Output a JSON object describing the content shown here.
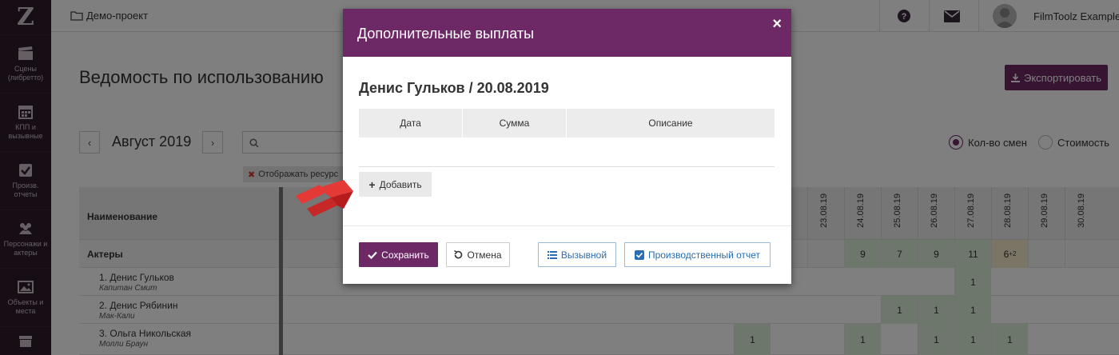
{
  "sidebar": {
    "logo": "Z",
    "items": [
      {
        "label": "Сцены (либретто)",
        "icon": "clapperboard-icon"
      },
      {
        "label": "КПП и вызывные",
        "icon": "calendar-icon"
      },
      {
        "label": "Произв. отчеты",
        "icon": "checkbox-icon"
      },
      {
        "label": "Персонажи и актеры",
        "icon": "people-icon"
      },
      {
        "label": "Объекты и места",
        "icon": "image-icon"
      }
    ]
  },
  "topbar": {
    "breadcrumb": "Демо-проект",
    "user_name": "FilmToolz Example"
  },
  "page": {
    "title": "Ведомость по использованию",
    "export_label": "Экспортировать",
    "month": "Август 2019",
    "radio_shifts": "Кол-во смен",
    "radio_cost": "Стоимость",
    "filter_label": "Отображать ресурс"
  },
  "table": {
    "name_header": "Наименование",
    "dates": [
      "23.08.19",
      "24.08.19",
      "25.08.19",
      "26.08.19",
      "27.08.19",
      "28.08.19",
      "29.08.19",
      "30.08.19"
    ],
    "group": {
      "label": "Актеры",
      "values": [
        "",
        "9",
        "7",
        "9",
        "11",
        "6",
        "",
        ""
      ],
      "extra": "+2"
    },
    "rows": [
      {
        "name": "1. Денис Гульков",
        "role": "Капитан Смит"
      },
      {
        "name": "2. Денис Рябинин",
        "role": "Мак-Кали"
      },
      {
        "name": "3. Ольга Никольская",
        "role": "Молли Браун"
      }
    ],
    "cell_one": "1"
  },
  "modal": {
    "title": "Дополнительные выплаты",
    "close": "×",
    "subtitle": "Денис Гульков / 20.08.2019",
    "columns": [
      "Дата",
      "Сумма",
      "Описание"
    ],
    "add_label": "Добавить",
    "save_label": "Сохранить",
    "cancel_label": "Отмена",
    "call_label": "Вызывной",
    "report_label": "Производственный отчет"
  },
  "colors": {
    "brand": "#6d2965",
    "sidebar": "#2e1a2a",
    "highlight_green": "#dcefd8",
    "arrow_red": "#e53935"
  }
}
